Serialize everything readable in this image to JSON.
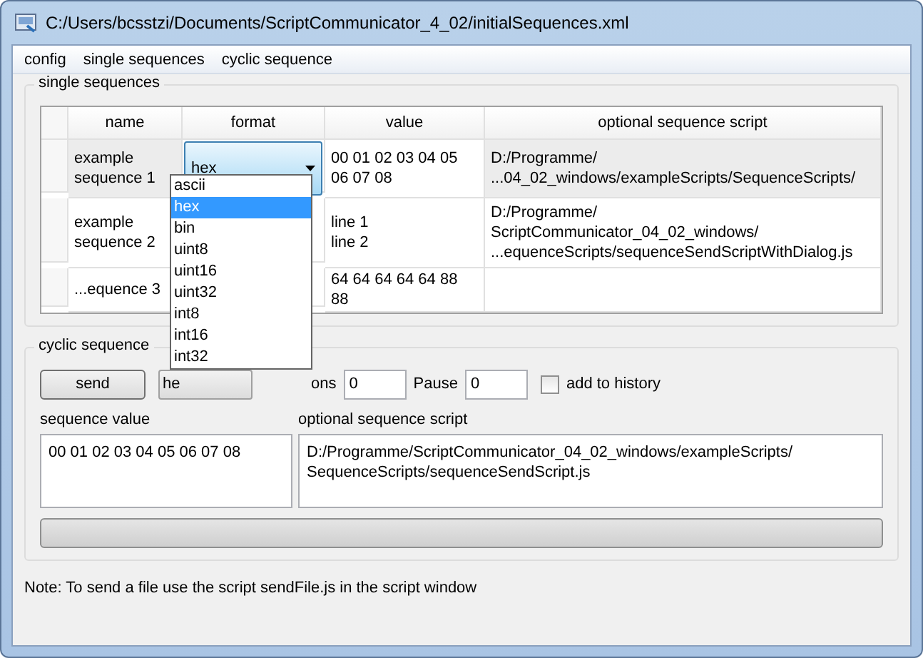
{
  "window": {
    "title": "C:/Users/bcsstzi/Documents/ScriptCommunicator_4_02/initialSequences.xml"
  },
  "menu": [
    "config",
    "single sequences",
    "cyclic sequence"
  ],
  "single_sequences": {
    "title": "single sequences",
    "columns": [
      "name",
      "format",
      "value",
      "optional sequence script"
    ],
    "rows": [
      {
        "name": "example sequence 1",
        "format": "hex",
        "value": "00 01 02 03 04 05 06 07 08",
        "script": "D:/Programme/\n...04_02_windows/exampleScripts/SequenceScripts/",
        "selected": true
      },
      {
        "name": "example sequence 2",
        "format": "",
        "value": "line 1\nline 2",
        "script": "D:/Programme/\nScriptCommunicator_04_02_windows/\n...equenceScripts/sequenceSendScriptWithDialog.js",
        "selected": false
      },
      {
        "name": "...equence 3",
        "format": "",
        "value": "64 64 64 64 64 88 88",
        "script": "",
        "selected": false
      }
    ],
    "format_popup": [
      {
        "label": "ascii",
        "selected": false
      },
      {
        "label": "hex",
        "selected": true
      },
      {
        "label": "bin",
        "selected": false
      },
      {
        "label": "uint8",
        "selected": false
      },
      {
        "label": "uint16",
        "selected": false
      },
      {
        "label": "uint32",
        "selected": false
      },
      {
        "label": "int8",
        "selected": false
      },
      {
        "label": "int16",
        "selected": false
      },
      {
        "label": "int32",
        "selected": false
      }
    ]
  },
  "cyclic_sequence": {
    "title": "cyclic sequence",
    "send_button": "send",
    "format_value": "he",
    "repetitions_label": "ons",
    "repetitions": "0",
    "pause_label": "Pause",
    "pause": "0",
    "add_to_history": {
      "label": "add to history",
      "checked": false
    },
    "sequence_value_label": "sequence value",
    "sequence_value": "00 01 02 03 04 05 06 07 08",
    "script_label": "optional sequence script",
    "script": "D:/Programme/ScriptCommunicator_04_02_windows/exampleScripts/\nSequenceScripts/sequenceSendScript.js"
  },
  "note": "Note: To send a file use the script sendFile.js in the script window"
}
